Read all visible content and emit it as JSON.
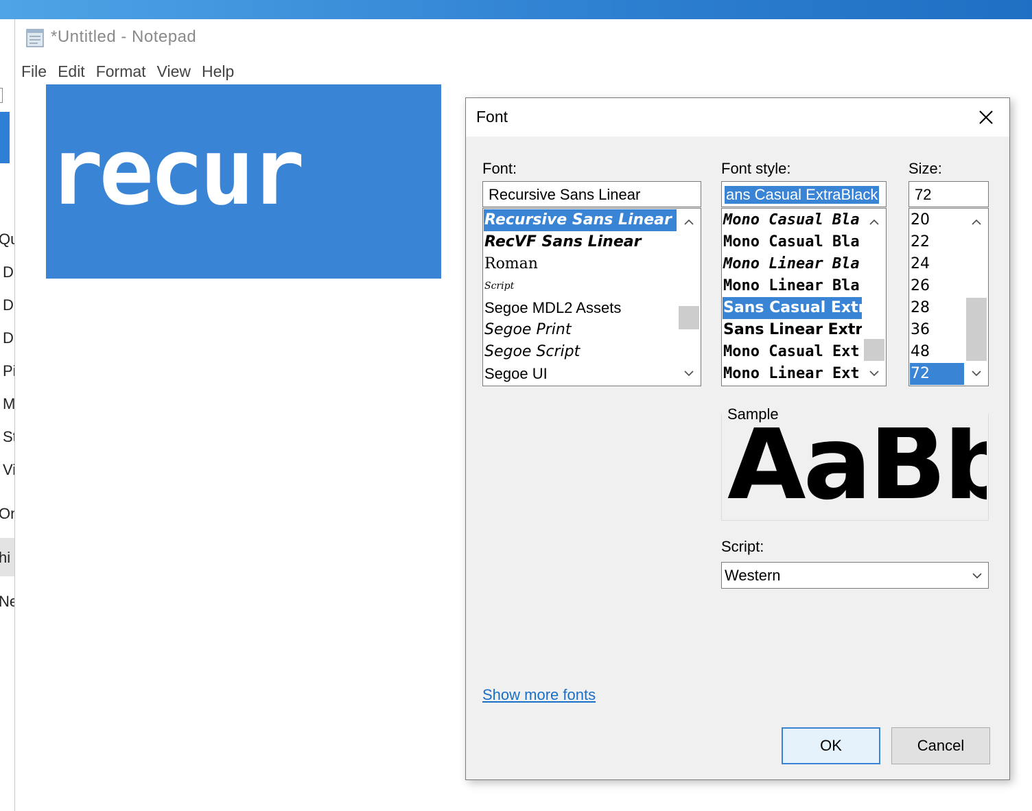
{
  "window": {
    "title": "*Untitled - Notepad",
    "menu": [
      "File",
      "Edit",
      "Format",
      "View",
      "Help"
    ]
  },
  "editor": {
    "text": "recur"
  },
  "background_explorer": {
    "items": [
      "Qui",
      "D",
      "D",
      "D",
      "Pi",
      "M",
      "St",
      "Vi",
      "On",
      "hi",
      "Net"
    ]
  },
  "font_dialog": {
    "title": "Font",
    "font_label": "Font:",
    "font_value": "Recursive Sans Linear",
    "font_list": [
      {
        "label": "Recursive Sans Linear",
        "selected": true,
        "style": "f-italic-bold"
      },
      {
        "label": "RecVF Sans Linear",
        "selected": false,
        "style": "f-italic-bold"
      },
      {
        "label": "Roman",
        "selected": false,
        "style": "f-serif"
      },
      {
        "label": "Script",
        "selected": false,
        "style": "f-script"
      },
      {
        "label": "Segoe MDL2 Assets",
        "selected": false,
        "style": "f-sans"
      },
      {
        "label": "Segoe Print",
        "selected": false,
        "style": "f-print"
      },
      {
        "label": "Segoe Script",
        "selected": false,
        "style": "f-print"
      },
      {
        "label": "Segoe UI",
        "selected": false,
        "style": "f-sans"
      }
    ],
    "style_label": "Font style:",
    "style_value": "ans Casual ExtraBlack",
    "style_list": [
      {
        "label": "Mono Casual Bla",
        "selected": false,
        "style": "f-mono-black-it"
      },
      {
        "label": "Mono Casual Bla",
        "selected": false,
        "style": "f-mono-black"
      },
      {
        "label": "Mono Linear Bla",
        "selected": false,
        "style": "f-mono-black-it"
      },
      {
        "label": "Mono Linear Bla",
        "selected": false,
        "style": "f-mono-black"
      },
      {
        "label": "Sans Casual Extra",
        "selected": true,
        "style": "f-sans-black"
      },
      {
        "label": "Sans Linear Extra",
        "selected": false,
        "style": "f-sans-black"
      },
      {
        "label": "Mono Casual Ext",
        "selected": false,
        "style": "f-mono-black"
      },
      {
        "label": "Mono Linear Ext",
        "selected": false,
        "style": "f-mono-black"
      }
    ],
    "size_label": "Size:",
    "size_value": "72",
    "size_list": [
      {
        "label": "20",
        "selected": false
      },
      {
        "label": "22",
        "selected": false
      },
      {
        "label": "24",
        "selected": false
      },
      {
        "label": "26",
        "selected": false
      },
      {
        "label": "28",
        "selected": false
      },
      {
        "label": "36",
        "selected": false
      },
      {
        "label": "48",
        "selected": false
      },
      {
        "label": "72",
        "selected": true
      }
    ],
    "sample_label": "Sample",
    "sample_text": "AaBb",
    "script_label": "Script:",
    "script_value": "Western",
    "show_more": "Show more fonts",
    "ok": "OK",
    "cancel": "Cancel"
  }
}
